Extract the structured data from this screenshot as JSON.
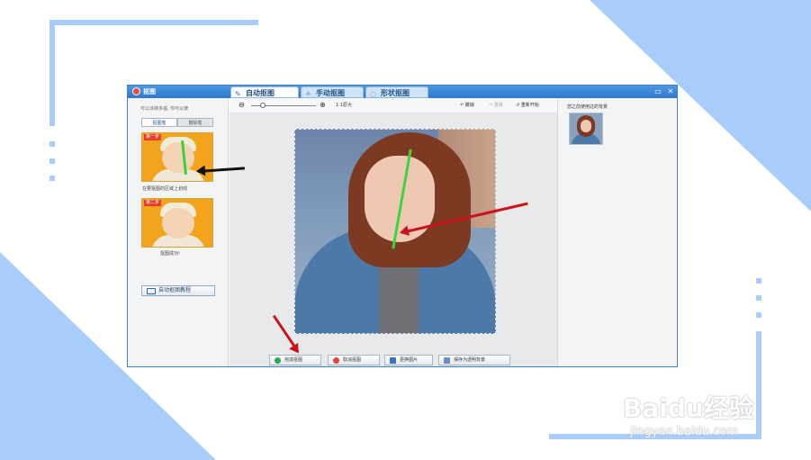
{
  "window": {
    "title": "抠图",
    "min_label": "▭",
    "close_label": "✕"
  },
  "tabs": [
    {
      "icon": "✎",
      "label": "自动抠图",
      "active": true
    },
    {
      "icon": "✧",
      "label": "手动抠图",
      "active": false
    },
    {
      "icon": "◌",
      "label": "形状抠图",
      "active": false
    }
  ],
  "left": {
    "hint": "可以涂抹多遍, 你可以使",
    "tab_brush": "抠图笔",
    "tab_delete": "删除笔",
    "example1": {
      "badge": "第一步",
      "caption": "在要抠图的区域上划线"
    },
    "example2": {
      "badge": "第二步",
      "caption": "抠图成功!"
    },
    "tutorial_button": "自动抠图教程"
  },
  "toolbar": {
    "zoom_out_icon": "⊖",
    "zoom_in_icon": "⊕",
    "ratio_label": "1:1原大",
    "undo": "撤销",
    "redo": "重做",
    "restart": "重新开始"
  },
  "actions": {
    "complete": "完成抠图",
    "cancel": "取消抠图",
    "replace": "更换图片",
    "save_transparent": "保存为透明背景"
  },
  "right": {
    "title": "您之前使用过的背景"
  },
  "watermark": {
    "brand": "Baidu经验",
    "url": "jingyan.baidu.com"
  },
  "colors": {
    "accent": "#a9cdfb",
    "title_bar": "#2f77cc",
    "arrow_red": "#c9141b",
    "stroke_green": "#3ed33e"
  }
}
